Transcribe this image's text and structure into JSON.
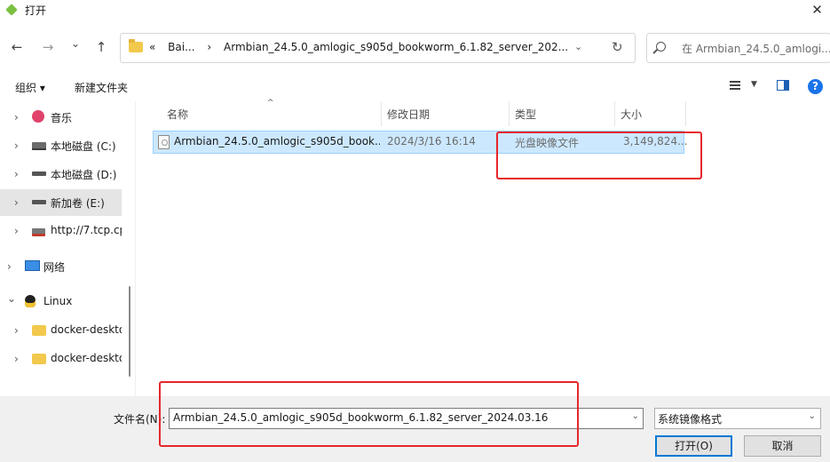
{
  "window": {
    "title": "打开",
    "close_glyph": "✕"
  },
  "nav": {
    "back_glyph": "←",
    "forward_glyph": "→",
    "recent_glyph": "⌄",
    "up_glyph": "↑",
    "address": {
      "overflow": "«",
      "segments": [
        "Bai...",
        "›",
        "Armbian_24.5.0_amlogic_s905d_bookworm_6.1.82_server_202..."
      ],
      "dropdown_glyph": "⌄",
      "refresh_glyph": "↻"
    },
    "search": {
      "placeholder": "在 Armbian_24.5.0_amlogi..."
    }
  },
  "toolbar": {
    "organize_label": "组织 ▾",
    "new_folder_label": "新建文件夹",
    "view_dropdown_glyph": "▼",
    "help_glyph": "?"
  },
  "sidebar": {
    "items": [
      {
        "label": "音乐",
        "icon": "music-icon",
        "chevron": "›"
      },
      {
        "label": "本地磁盘 (C:)",
        "icon": "windows-drive-icon",
        "chevron": "›"
      },
      {
        "label": "本地磁盘 (D:)",
        "icon": "drive-icon",
        "chevron": "›"
      },
      {
        "label": "新加卷 (E:)",
        "icon": "drive-icon",
        "chevron": "›",
        "selected": true
      },
      {
        "label": "http://7.tcp.cp",
        "icon": "network-drive-icon",
        "chevron": "›"
      },
      {
        "label": "网络",
        "icon": "network-icon",
        "chevron": "›"
      },
      {
        "label": "Linux",
        "icon": "linux-penguin-icon",
        "chevron": "⌄"
      },
      {
        "label": "docker-deskto",
        "icon": "folder-icon",
        "chevron": "›"
      },
      {
        "label": "docker-deskto",
        "icon": "folder-icon",
        "chevron": "›"
      }
    ]
  },
  "filelist": {
    "columns": [
      "名称",
      "修改日期",
      "类型",
      "大小"
    ],
    "sort_glyph": "^",
    "rows": [
      {
        "name": "Armbian_24.5.0_amlogic_s905d_book...",
        "modified": "2024/3/16 16:14",
        "type": "光盘映像文件",
        "size": "3,149,824..."
      }
    ]
  },
  "bottom": {
    "filename_label": "文件名(N):",
    "filename_value": "Armbian_24.5.0_amlogic_s905d_bookworm_6.1.82_server_2024.03.16",
    "dropdown_glyph": "⌄",
    "filetype_value": "系统镜像格式",
    "open_label": "打开(O)",
    "cancel_label": "取消"
  },
  "colors": {
    "accent": "#0078d4",
    "selection": "#cce8ff",
    "annotation_red": "#e6262c"
  }
}
